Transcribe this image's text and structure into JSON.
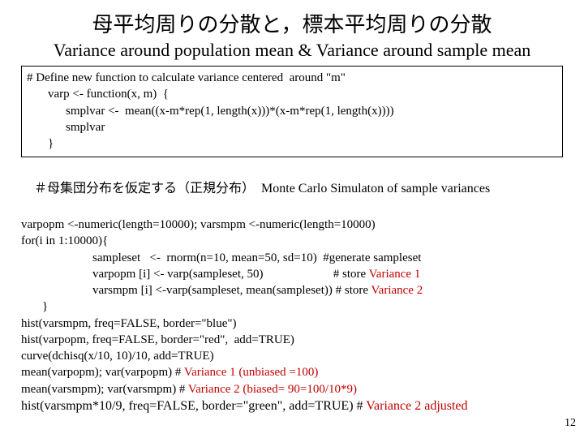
{
  "title_jp": "母平均周りの分散と，標本平均周りの分散",
  "title_en": "Variance around population mean & Variance around sample mean",
  "block1": {
    "l1": "# Define new function to calculate variance centered  around \"m\"",
    "l2": "varp <- function(x, m)  {",
    "l3": "smplvar <-  mean((x-m*rep(1, length(x)))*(x-m*rep(1, length(x))))",
    "l4": "smplvar",
    "l5": "}"
  },
  "subtitle": {
    "jp": "＃母集団分布を仮定する（正規分布）",
    "en": "  Monte Carlo Simulaton of sample variances"
  },
  "body2": {
    "l1": "varpopm <-numeric(length=10000); varsmpm <-numeric(length=10000)",
    "l2": "for(i in 1:10000){",
    "l3": "sampleset   <-  rnorm(n=10, mean=50, sd=10)  #generate sampleset",
    "l4a": "varpopm [i] <- varp(sampleset, 50)                       # store ",
    "l4b": "Variance 1",
    "l5a": "varsmpm [i] <-varp(sampleset, mean(sampleset)) # store ",
    "l5b": "Variance 2",
    "l6": "}",
    "l7": "hist(varsmpm, freq=FALSE, border=\"blue\")",
    "l8": "hist(varpopm, freq=FALSE, border=\"red\",  add=TRUE)",
    "l9": "curve(dchisq(x/10, 10)/10, add=TRUE)",
    "l10a": "mean(varpopm); var(varpopm) # ",
    "l10b": "Variance 1 (unbiased =100)",
    "l11a": "mean(varsmpm); var(varsmpm) # ",
    "l11b": "Variance 2 (biased= 90=100/10*9)"
  },
  "bottom": {
    "a": "hist(varsmpm*10/9, freq=FALSE, border=\"green\", add=TRUE) # ",
    "b": "Variance 2 adjusted"
  },
  "pagenum": "12"
}
